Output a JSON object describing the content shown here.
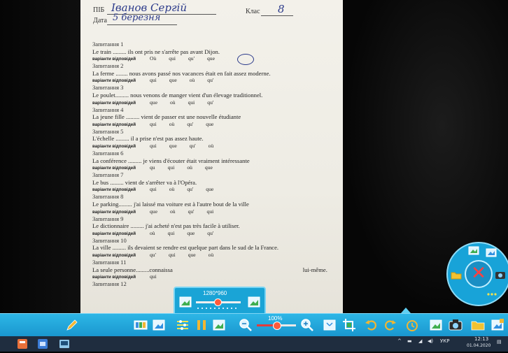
{
  "document": {
    "pib_label": "ПІБ",
    "pib_value": "Іванов  Сергій",
    "class_label": "Клас",
    "class_value": "8",
    "date_label": "Дата",
    "date_value": "5 березня",
    "options_label": "варіанти відповідей",
    "tasks": [
      {
        "title": "Запитання 1",
        "sentence": "Le train ......... ils ont pris ne s'arrête pas avant Dijon.",
        "options": [
          "Où",
          "qui",
          "qu'",
          "que"
        ],
        "circled": 2
      },
      {
        "title": "Запитання 2",
        "sentence": "La ferme ........ nous avons passé nos vacances était en fait assez moderne.",
        "options": [
          "qui",
          "que",
          "où",
          "qu'"
        ]
      },
      {
        "title": "Запитання 3",
        "sentence": "Le poulet......... nous venons de manger vient d'un élevage traditionnel.",
        "options": [
          "que",
          "où",
          "qui",
          "qu'"
        ]
      },
      {
        "title": "Запитання 4",
        "sentence": "La jeune fille ......... vient de passer est une nouvelle étudiante",
        "options": [
          "qui",
          "où",
          "qu'",
          "que"
        ]
      },
      {
        "title": "Запитання 5",
        "sentence": "L'échelle ......... il a prise n'est pas assez haute.",
        "options": [
          "qui",
          "que",
          "qu'",
          "où"
        ]
      },
      {
        "title": "Запитання 6",
        "sentence": "La conférence ......... je viens d'écouter était vraiment intéressante",
        "options": [
          "qu",
          "qui",
          "où",
          "que"
        ]
      },
      {
        "title": "Запитання 7",
        "sentence": "Le bus ......... vient de s'arrêter va à l'Opéra.",
        "options": [
          "qui",
          "où",
          "qu'",
          "que"
        ]
      },
      {
        "title": "Запитання 8",
        "sentence": "Le parking......... j'ai laissé ma voiture est à l'autre bout de la ville",
        "options": [
          "que",
          "où",
          "qu'",
          "qui"
        ]
      },
      {
        "title": "Запитання 9",
        "sentence": "Le dictionnaire ......... j'ai acheté n'est pas très facile à utiliser.",
        "options": [
          "où",
          "qui",
          "que",
          "qu'"
        ]
      },
      {
        "title": "Запитання 10",
        "sentence": "La ville ......... ils devaient se rendre est quelque part dans le sud de la France.",
        "options": [
          "qu'",
          "qui",
          "que",
          "où"
        ]
      },
      {
        "title": "Запитання 11",
        "sentence": "La seule personne.........connaissa",
        "sentence_tail": "lui-même.",
        "options": [
          "qui"
        ]
      },
      {
        "title": "Запитання 12",
        "sentence": "",
        "options": []
      }
    ]
  },
  "toolbar": {
    "zoom_value": 100,
    "zoom_label": "100%",
    "resolution_label": "1280*960",
    "icons": [
      "pen-icon",
      "thumbnails-icon",
      "gallery-icon",
      "adjust-icon",
      "pause-icon",
      "scan-icon",
      "zoom-out-icon",
      "zoom-in-icon",
      "fit-icon",
      "crop-icon",
      "rotate-left-icon",
      "rotate-right-icon",
      "timer-icon",
      "capture-icon",
      "camera-icon",
      "folder-icon",
      "export-icon"
    ]
  },
  "radial_menu": {
    "close_symbol": "✕",
    "items": [
      "tile-icon",
      "gallery-icon",
      "folder-icon",
      "camera-icon",
      "more-icon"
    ]
  },
  "taskbar": {
    "language": "УКР",
    "time": "12:13",
    "date": "01.04.2020",
    "apps": [
      "calculator-app-icon",
      "explorer-app-icon",
      "terminal-app-icon"
    ]
  },
  "colors": {
    "toolbar": "#1da4d8",
    "accent_red": "#ff4040",
    "handwriting": "#2b3a8a"
  }
}
